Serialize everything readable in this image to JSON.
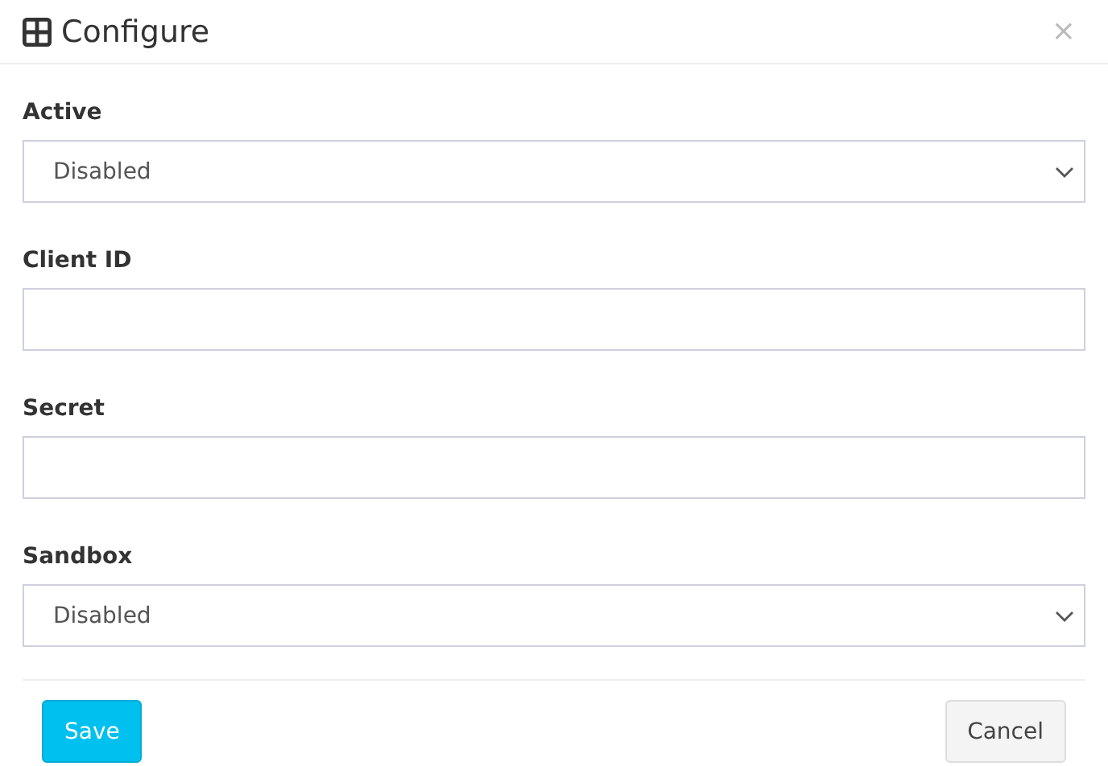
{
  "dialog": {
    "title": "Configure",
    "close": "×"
  },
  "fields": [
    {
      "label": "Active",
      "kind": "select",
      "value": "Disabled"
    },
    {
      "label": "Client ID",
      "kind": "text"
    },
    {
      "label": "Secret",
      "kind": "text"
    },
    {
      "label": "Sandbox",
      "kind": "select",
      "value": "Disabled"
    }
  ],
  "buttons": [
    {
      "label": "Save",
      "kind": "primary"
    },
    {
      "label": "Cancel",
      "kind": "default"
    }
  ]
}
